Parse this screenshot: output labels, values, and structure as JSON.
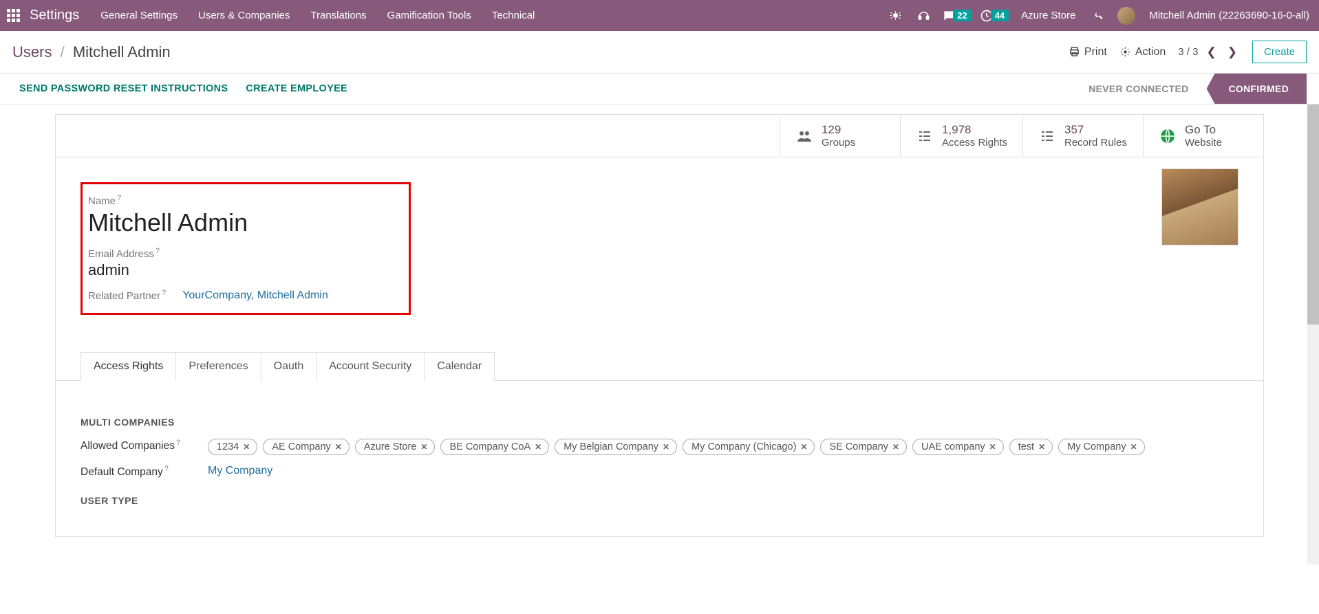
{
  "topbar": {
    "brand": "Settings",
    "nav": [
      "General Settings",
      "Users & Companies",
      "Translations",
      "Gamification Tools",
      "Technical"
    ],
    "msg_count": "22",
    "timer_count": "44",
    "store": "Azure Store",
    "user": "Mitchell Admin (22263690-16-0-all)"
  },
  "breadcrumb": {
    "root": "Users",
    "current": "Mitchell Admin"
  },
  "controls": {
    "print": "Print",
    "action": "Action",
    "pager": "3 / 3",
    "create": "Create"
  },
  "actions": {
    "send": "SEND PASSWORD RESET INSTRUCTIONS",
    "emp": "CREATE EMPLOYEE"
  },
  "status": {
    "never": "NEVER CONNECTED",
    "confirmed": "CONFIRMED"
  },
  "stats": [
    {
      "num": "129",
      "lbl": "Groups"
    },
    {
      "num": "1,978",
      "lbl": "Access Rights"
    },
    {
      "num": "357",
      "lbl": "Record Rules"
    },
    {
      "num": "Go To",
      "lbl": "Website"
    }
  ],
  "form": {
    "name_lbl": "Name",
    "name_val": "Mitchell Admin",
    "email_lbl": "Email Address",
    "email_val": "admin",
    "partner_lbl": "Related Partner",
    "partner_val": "YourCompany, Mitchell Admin"
  },
  "tabs": [
    "Access Rights",
    "Preferences",
    "Oauth",
    "Account Security",
    "Calendar"
  ],
  "sections": {
    "multi": "MULTI COMPANIES",
    "allowed_lbl": "Allowed Companies",
    "default_lbl": "Default Company",
    "default_val": "My Company",
    "usertype": "USER TYPE"
  },
  "chips": [
    "1234",
    "AE Company",
    "Azure Store",
    "BE Company CoA",
    "My Belgian Company",
    "My Company (Chicago)",
    "SE Company",
    "UAE company",
    "test",
    "My Company"
  ]
}
